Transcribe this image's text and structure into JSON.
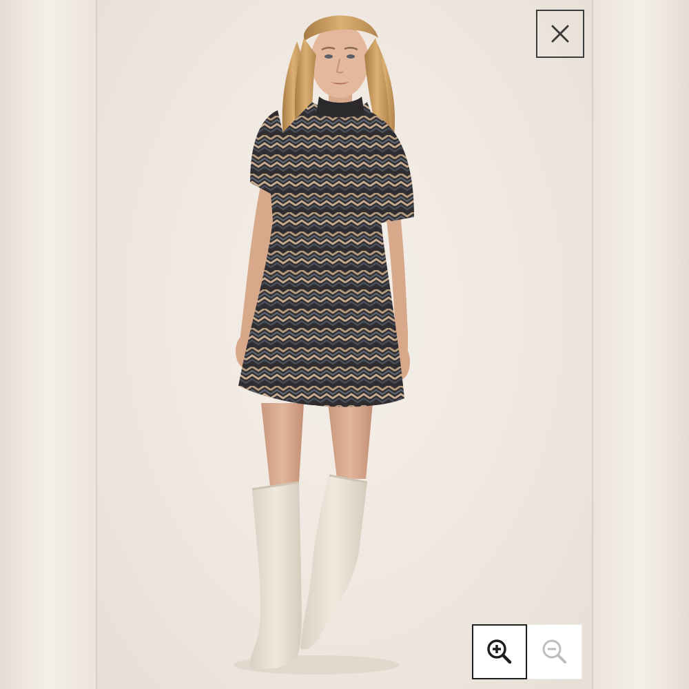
{
  "viewer": {
    "image_alt": "",
    "background_color": "#f2ede6"
  },
  "controls": {
    "close": {
      "icon": "close-icon",
      "color": "#3a3a3a"
    },
    "zoom_in": {
      "icon": "zoom-in-icon",
      "active": true,
      "color": "#1e1e1e"
    },
    "zoom_out": {
      "icon": "zoom-out-icon",
      "active": false,
      "color": "#bdbdbd"
    }
  },
  "colors": {
    "dress_dark": "#2f2d30",
    "dress_tan": "#b49a7f",
    "dress_slate": "#5d6470",
    "boots": "#ece3d6",
    "skin": "#dcae93",
    "hair": "#c79a5e"
  }
}
